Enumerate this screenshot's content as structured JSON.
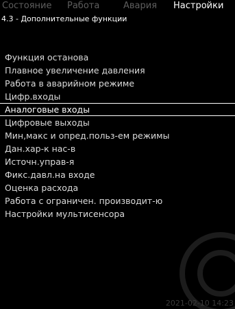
{
  "tabs": [
    {
      "label": "Состояние",
      "active": false
    },
    {
      "label": "Работа",
      "active": false
    },
    {
      "label": "Авария",
      "active": false
    },
    {
      "label": "Настройки",
      "active": true
    }
  ],
  "subtitle": "4.3 - Дополнительные функции",
  "menu": {
    "selected_index": 4,
    "items": [
      {
        "label": "Функция останова"
      },
      {
        "label": "Плавное увеличение давления"
      },
      {
        "label": "Работа в аварийном режиме"
      },
      {
        "label": "Цифр.входы"
      },
      {
        "label": "Аналоговые входы"
      },
      {
        "label": "Цифровые выходы"
      },
      {
        "label": "Мин,макс и опред.польз-ем режимы"
      },
      {
        "label": "Дан.хар-к нас-в"
      },
      {
        "label": "Источн.управ-я"
      },
      {
        "label": "Фикс.давл.на входе"
      },
      {
        "label": "Оценка расхода"
      },
      {
        "label": "Работа с ограничен. производит-ю"
      },
      {
        "label": "Настройки мультисенсора"
      }
    ]
  },
  "timestamp": "2021-02-10 14:23",
  "colors": {
    "background": "#000000",
    "inactive_tab": "#5e5e5e",
    "active_tab": "#ffffff",
    "text": "#dcdcdc"
  }
}
